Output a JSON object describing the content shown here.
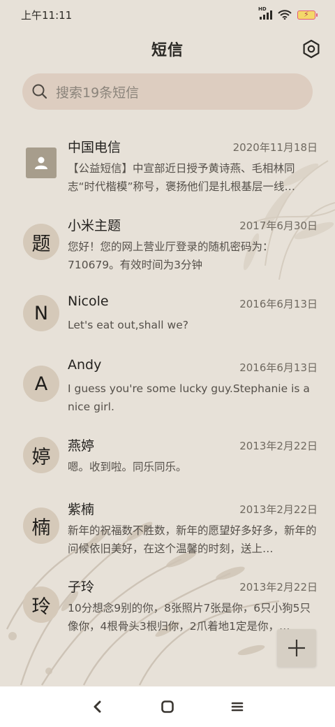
{
  "status_bar": {
    "time": "上午11:11",
    "signal": "HD",
    "battery_label": "⚡"
  },
  "header": {
    "title": "短信"
  },
  "search": {
    "placeholder": "搜索19条短信"
  },
  "messages": [
    {
      "avatar": "",
      "avatar_icon": "contact-icon",
      "name": "中国电信",
      "date": "2020年11月18日",
      "preview": "【公益短信】中宣部近日授予黄诗燕、毛相林同志“时代楷模”称号，褒扬他们是扎根基层一线…"
    },
    {
      "avatar": "题",
      "name": "小米主题",
      "date": "2017年6月30日",
      "preview": "您好！您的网上营业厅登录的随机密码为：710679。有效时间为3分钟"
    },
    {
      "avatar": "N",
      "name": "Nicole",
      "date": "2016年6月13日",
      "preview": "Let's eat out,shall we?"
    },
    {
      "avatar": "A",
      "name": "Andy",
      "date": "2016年6月13日",
      "preview": "I guess you're some lucky guy.Stephanie is a nice girl."
    },
    {
      "avatar": "婷",
      "name": "燕婷",
      "date": "2013年2月22日",
      "preview": "嗯。收到啦。同乐同乐。"
    },
    {
      "avatar": "楠",
      "name": "紫楠",
      "date": "2013年2月22日",
      "preview": "新年的祝福数不胜数，新年的愿望好多好多，新年的问候依旧美好，在这个温馨的时刻，送上…"
    },
    {
      "avatar": "玲",
      "name": "子玲",
      "date": "2013年2月22日",
      "preview": "10分想念9别的你，8张照片7张是你，6只小狗5只像你，4根骨头3根归你，2爪着地1定是你，…"
    }
  ],
  "fab": {
    "icon": "plus-icon"
  },
  "nav": {
    "back_icon": "back-icon",
    "home_icon": "home-icon",
    "menu_icon": "menu-icon"
  }
}
